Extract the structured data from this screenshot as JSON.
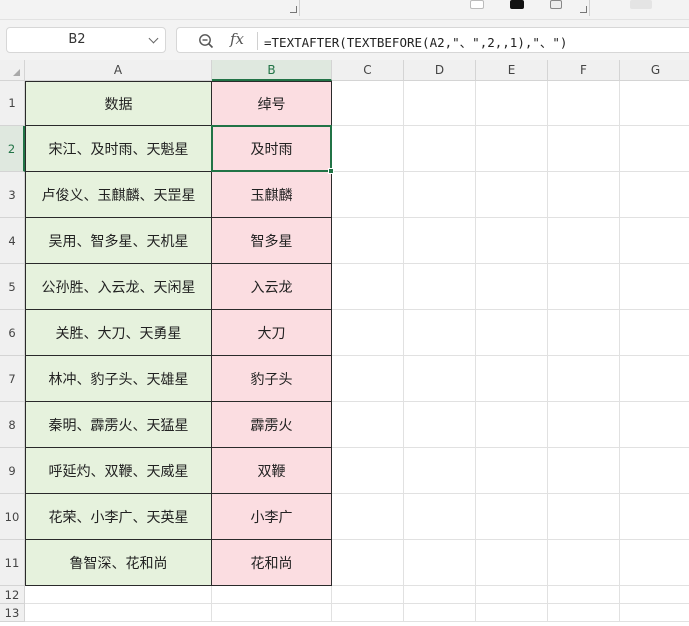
{
  "formula_bar": {
    "name_box": "B2",
    "fx_label": "fx",
    "formula": "=TEXTAFTER(TEXTBEFORE(A2,\"、\",2,,1),\"、\")"
  },
  "columns": [
    "A",
    "B",
    "C",
    "D",
    "E",
    "F",
    "G"
  ],
  "selected_column": "B",
  "rows": [
    "1",
    "2",
    "3",
    "4",
    "5",
    "6",
    "7",
    "8",
    "9",
    "10",
    "11",
    "12",
    "13"
  ],
  "selected_row": "2",
  "table": {
    "header": {
      "a": "数据",
      "b": "绰号"
    },
    "rows": [
      {
        "a": "宋江、及时雨、天魁星",
        "b": "及时雨"
      },
      {
        "a": "卢俊义、玉麒麟、天罡星",
        "b": "玉麒麟"
      },
      {
        "a": "吴用、智多星、天机星",
        "b": "智多星"
      },
      {
        "a": "公孙胜、入云龙、天闲星",
        "b": "入云龙"
      },
      {
        "a": "关胜、大刀、天勇星",
        "b": "大刀"
      },
      {
        "a": "林冲、豹子头、天雄星",
        "b": "豹子头"
      },
      {
        "a": "秦明、霹雳火、天猛星",
        "b": "霹雳火"
      },
      {
        "a": "呼延灼、双鞭、天威星",
        "b": "双鞭"
      },
      {
        "a": "花荣、小李广、天英星",
        "b": "小李广"
      },
      {
        "a": "鲁智深、花和尚",
        "b": "花和尚"
      }
    ]
  },
  "colors": {
    "accent": "#217346",
    "col_a_fill": "#e6f2dd",
    "col_b_fill": "#fbdde1"
  }
}
